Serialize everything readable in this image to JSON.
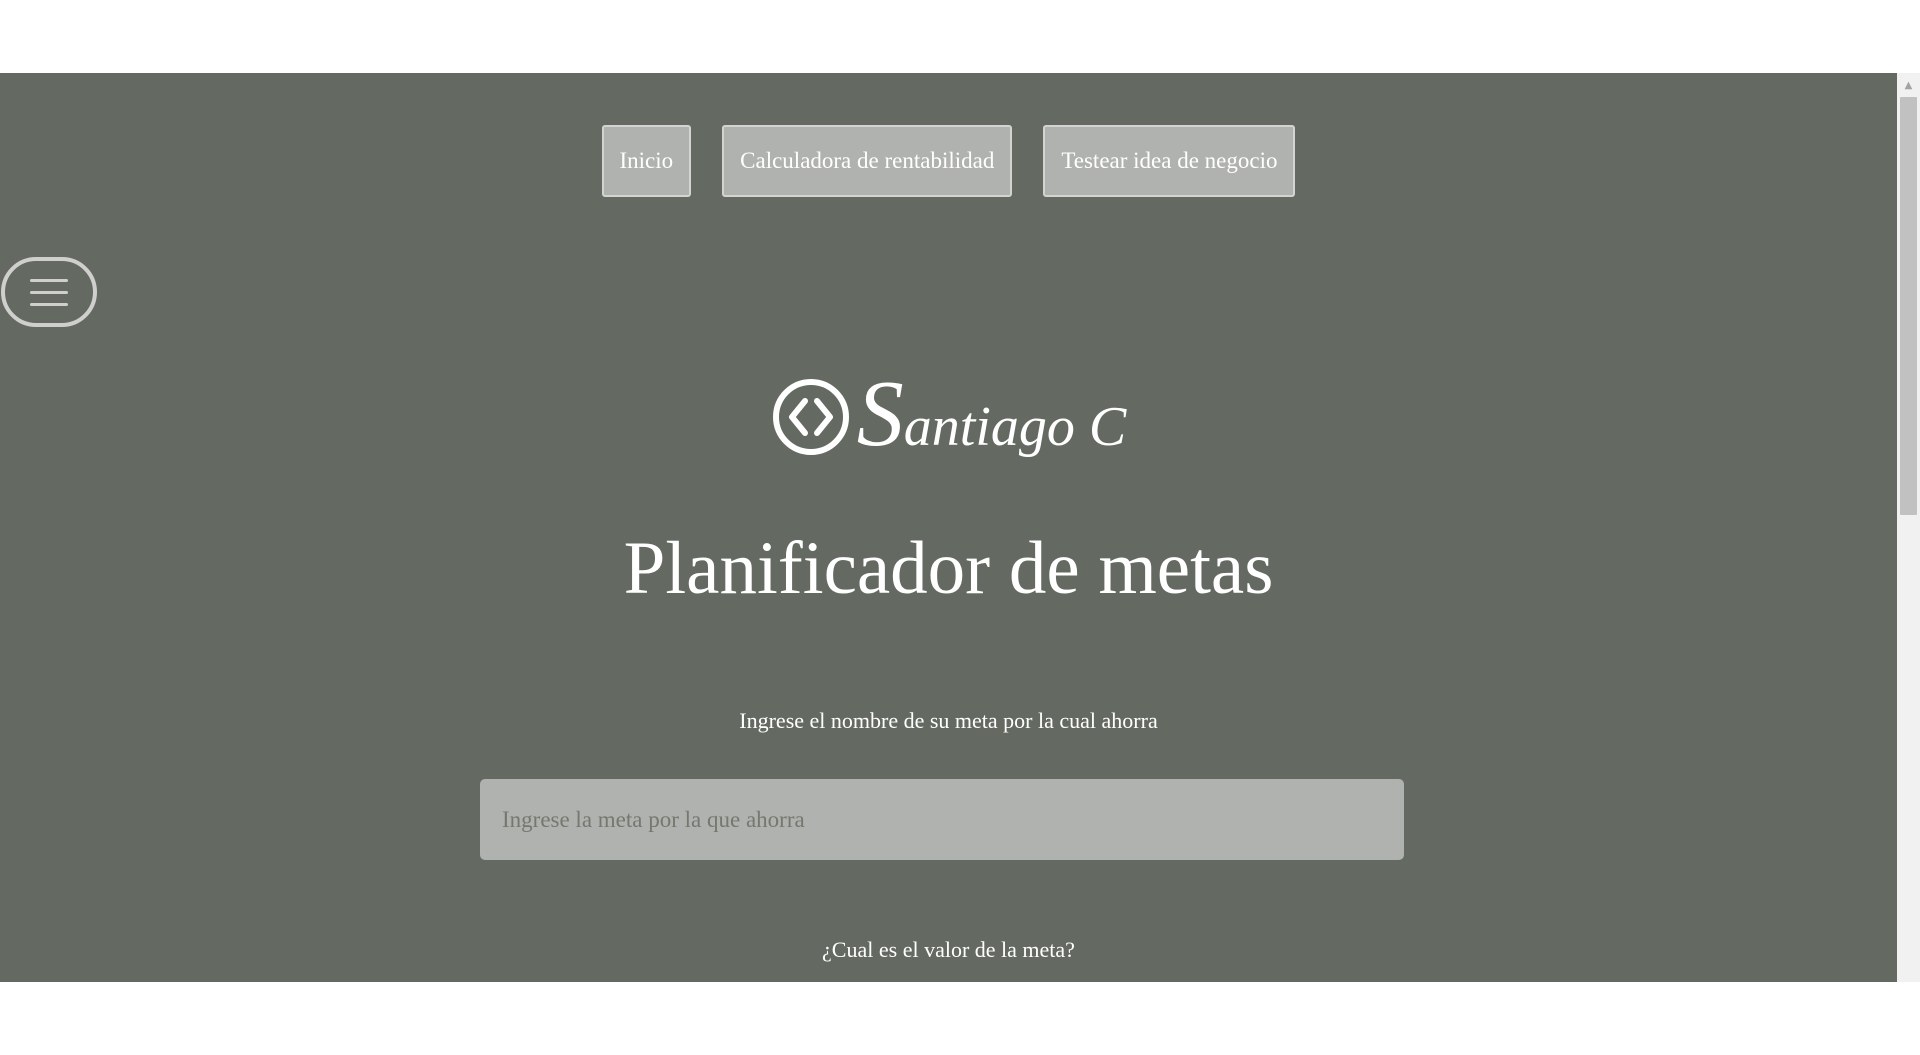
{
  "nav": {
    "items": [
      {
        "label": "Inicio"
      },
      {
        "label": "Calculadora de rentabilidad"
      },
      {
        "label": "Testear idea de negocio"
      }
    ]
  },
  "logo": {
    "first_letter": "S",
    "rest": "antiago C",
    "icon": "code-brackets-icon"
  },
  "page_title": "Planificador de metas",
  "form": {
    "goal_name_label": "Ingrese el nombre de su meta por la cual ahorra",
    "goal_name_placeholder": "Ingrese la meta por la que ahorra",
    "goal_name_value": "",
    "goal_value_label": "¿Cual es el valor de la meta?"
  },
  "colors": {
    "background": "#646a62",
    "button_bg": "#b0b2af",
    "text": "#ffffff"
  },
  "icons": {
    "menu": "hamburger-menu-icon",
    "logo": "code-brackets-icon",
    "scroll_up": "scroll-up-arrow-icon"
  }
}
